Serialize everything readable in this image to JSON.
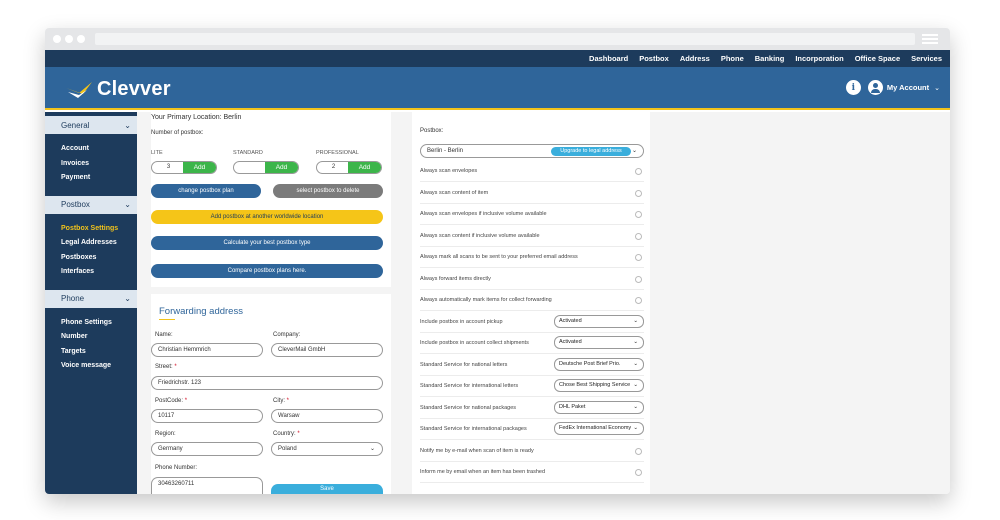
{
  "topnav": [
    "Dashboard",
    "Postbox",
    "Address",
    "Phone",
    "Banking",
    "Incorporation",
    "Office Space",
    "Services"
  ],
  "brand": {
    "name": "Clevver",
    "accent": "#f2c31b",
    "primary": "#2f659a",
    "dark": "#1d3b5c"
  },
  "header": {
    "info_icon": "i",
    "account_label": "My Account",
    "chevron": "⌄"
  },
  "sidebar": {
    "groups": [
      {
        "label": "General",
        "items": [
          "Account",
          "Invoices",
          "Payment"
        ]
      },
      {
        "label": "Postbox",
        "items": [
          "Postbox Settings",
          "Legal Addresses",
          "Postboxes",
          "Interfaces"
        ]
      },
      {
        "label": "Phone",
        "items": [
          "Phone Settings",
          "Number",
          "Targets",
          "Voice message"
        ]
      }
    ],
    "chevron": "⌄"
  },
  "postbox": {
    "primary_location": "Your Primary Location: Berlin",
    "number_label": "Number of postbox:",
    "plans": [
      {
        "name": "LITE",
        "value": "3",
        "add": "Add"
      },
      {
        "name": "STANDARD",
        "value": "",
        "add": "Add"
      },
      {
        "name": "PROFESSIONAL",
        "value": "2",
        "add": "Add"
      }
    ],
    "change_plan": "change postbox plan",
    "select_delete": "select postbox to delete",
    "add_worldwide": "Add postbox at another worldwide location",
    "calculate": "Calculate your best postbox type",
    "compare": "Compare postbox plans here."
  },
  "forwarding": {
    "title": "Forwarding address",
    "name_label": "Name:",
    "name_value": "Christian Hemmrich",
    "company_label": "Company:",
    "company_value": "CleverMail GmbH",
    "street_label": "Street:",
    "street_value": "Friedrichstr. 123",
    "postcode_label": "PostCode:",
    "postcode_value": "10117",
    "city_label": "City:",
    "city_value": "Warsaw",
    "region_label": "Region:",
    "region_value": "Germany",
    "country_label": "Country:",
    "country_value": "Poland",
    "phone_label": "Phone Number:",
    "phone_value": "30463260711",
    "save_label": "Save",
    "required_mark": "*"
  },
  "settings": {
    "postbox_label": "Postbox:",
    "postbox_value": "Berlin - Berlin",
    "upgrade_label": "Upgrade to legal address",
    "rows": [
      {
        "label": "Always scan envelopes",
        "kind": "check"
      },
      {
        "label": "Always scan content of item",
        "kind": "check"
      },
      {
        "label": "Always scan envelopes if inclusive volume available",
        "kind": "check"
      },
      {
        "label": "Always scan content if inclusive volume available",
        "kind": "check"
      },
      {
        "label": "Always mark all scans to be sent to your preferred email address",
        "kind": "check"
      },
      {
        "label": "Always forward items directly",
        "kind": "check"
      },
      {
        "label": "Always automatically mark items for collect forwarding",
        "kind": "check"
      },
      {
        "label": "Include postbox in account pickup",
        "kind": "select",
        "value": "Activated"
      },
      {
        "label": "Include postbox in account collect shipments",
        "kind": "select",
        "value": "Activated"
      },
      {
        "label": "Standard Service for national letters",
        "kind": "select",
        "value": "Deutsche Post Brief Prio."
      },
      {
        "label": "Standard Service for international letters",
        "kind": "select",
        "value": "Chose Best Shipping Service"
      },
      {
        "label": "Standard Service for national packages",
        "kind": "select",
        "value": "DHL Paket"
      },
      {
        "label": "Standard Service for international packages",
        "kind": "select",
        "value": "FedEx International Economy"
      },
      {
        "label": "Notify me by e-mail when scan of item is ready",
        "kind": "check"
      },
      {
        "label": "Inform me by email when an item has been trashed",
        "kind": "check"
      }
    ]
  }
}
